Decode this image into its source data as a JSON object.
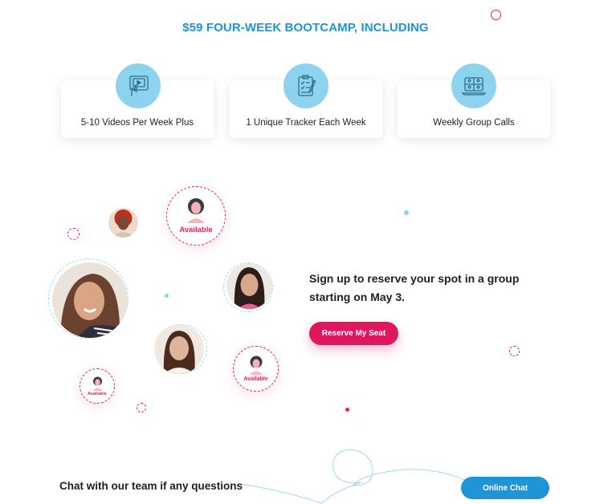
{
  "heading": "$59 FOUR-WEEK BOOTCAMP, INCLUDING",
  "features": [
    {
      "label": "5-10 Videos Per Week Plus",
      "icon": "video-tablet-icon"
    },
    {
      "label": "1 Unique Tracker Each Week",
      "icon": "checklist-clipboard-icon"
    },
    {
      "label": "Weekly Group Calls",
      "icon": "group-call-laptop-icon"
    }
  ],
  "community": {
    "available_label": "Available",
    "signup_text": "Sign up to reserve your spot in a group starting on May 3.",
    "reserve_button": "Reserve My Seat"
  },
  "chat": {
    "text": "Chat with our team if any questions",
    "button": "Online Chat"
  },
  "colors": {
    "accent_blue": "#1d95d6",
    "accent_pink": "#e0175f",
    "icon_bg": "#8ed3ee"
  }
}
